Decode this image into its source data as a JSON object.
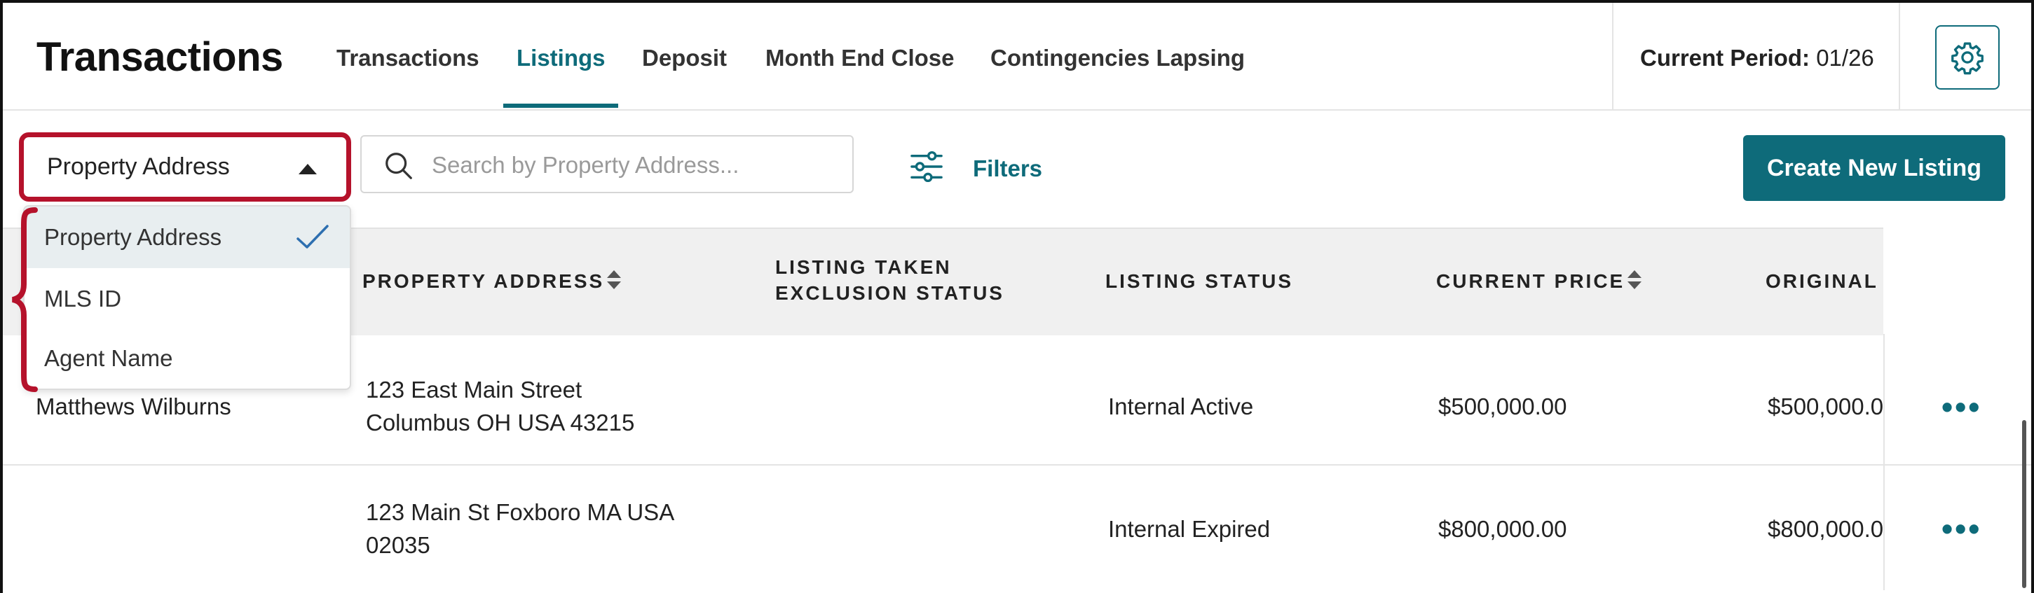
{
  "header": {
    "title": "Transactions",
    "tabs": [
      {
        "label": "Transactions",
        "active": false
      },
      {
        "label": "Listings",
        "active": true
      },
      {
        "label": "Deposit",
        "active": false
      },
      {
        "label": "Month End Close",
        "active": false
      },
      {
        "label": "Contingencies Lapsing",
        "active": false
      }
    ],
    "period_label": "Current Period:",
    "period_value": "01/26",
    "settings_icon": "gear-icon"
  },
  "toolbar": {
    "search_by": {
      "selected": "Property Address",
      "icon": "caret-up-icon"
    },
    "search": {
      "placeholder": "Search by Property Address...",
      "icon": "search-icon"
    },
    "filters": {
      "label": "Filters",
      "icon": "sliders-icon"
    },
    "create_button": "Create New Listing"
  },
  "dropdown": {
    "options": [
      {
        "label": "Property Address",
        "selected": true
      },
      {
        "label": "MLS ID",
        "selected": false
      },
      {
        "label": "Agent Name",
        "selected": false
      }
    ]
  },
  "table": {
    "columns": [
      {
        "label": "PROPERTY ADDRESS",
        "sortable": true
      },
      {
        "label_line1": "LISTING TAKEN",
        "label_line2": "EXCLUSION STATUS",
        "sortable": false
      },
      {
        "label": "LISTING STATUS",
        "sortable": false
      },
      {
        "label": "CURRENT PRICE",
        "sortable": true
      },
      {
        "label": "ORIGINAL",
        "sortable": false
      }
    ],
    "rows": [
      {
        "agent": "Matthews Wilburns",
        "address_line1": "123 East Main Street",
        "address_line2": "Columbus OH USA 43215",
        "exclusion_status": "",
        "status": "Internal Active",
        "current_price": "$500,000.00",
        "original_price": "$500,000.0"
      },
      {
        "agent": "",
        "address_line1": "123 Main St Foxboro MA USA",
        "address_line2": "02035",
        "exclusion_status": "",
        "status": "Internal Expired",
        "current_price": "$800,000.00",
        "original_price": "$800,000.0"
      }
    ],
    "row_action": "•••"
  },
  "colors": {
    "accent": "#0e6b7a",
    "highlight": "#b5122b",
    "header_bg": "#f0f0f0"
  }
}
